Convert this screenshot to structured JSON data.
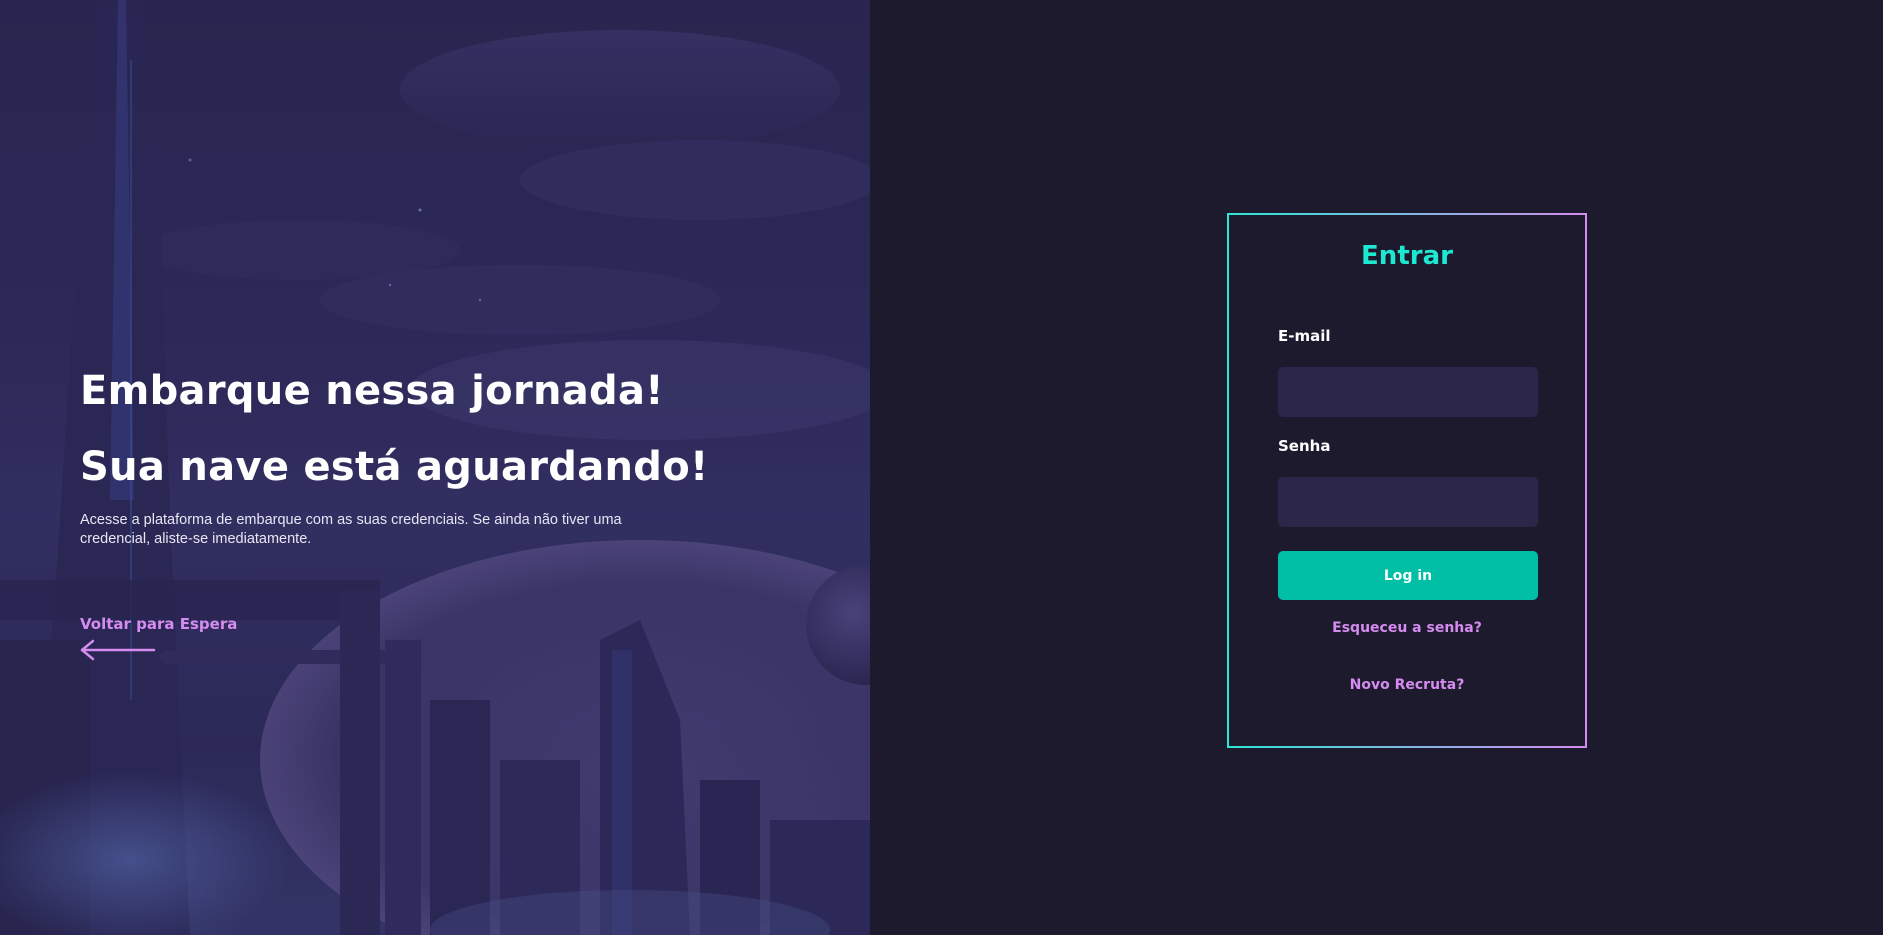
{
  "hero": {
    "title_line1": "Embarque nessa jornada!",
    "title_line2": "Sua nave está aguardando!",
    "description": "Acesse a plataforma de embarque com as suas credenciais. Se ainda não tiver uma credencial, aliste-se imediatamente.",
    "back_link_label": "Voltar para Espera",
    "back_icon": "arrow-left-icon"
  },
  "login": {
    "title": "Entrar",
    "email_label": "E-mail",
    "email_value": "",
    "password_label": "Senha",
    "password_value": "",
    "submit_label": "Log in",
    "forgot_link": "Esqueceu a senha?",
    "signup_link": "Novo Recruta?"
  },
  "colors": {
    "background": "#1e1a2e",
    "accent_teal": "#1de9d2",
    "button_teal": "#00bfa5",
    "link_pink": "#d58cf0",
    "input_bg": "#2c2648"
  }
}
